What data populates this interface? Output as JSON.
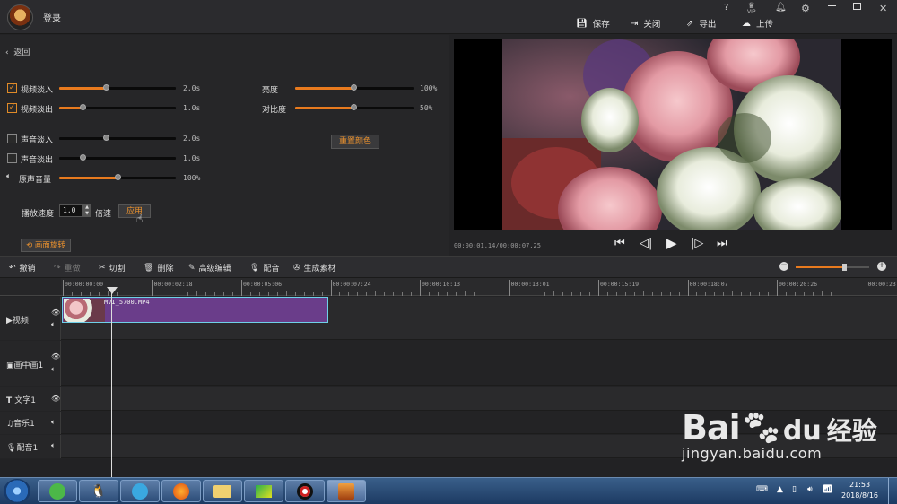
{
  "titlebar": {
    "login": "登录",
    "actions": {
      "save": "保存",
      "close": "关闭",
      "export": "导出",
      "upload": "上传"
    },
    "icons": [
      "help-icon",
      "vip-icon",
      "bell-icon",
      "gear-icon",
      "minimize-icon",
      "restore-icon",
      "close-icon"
    ],
    "help": "?",
    "vip": "VIP"
  },
  "left": {
    "back": "返回",
    "rows": [
      {
        "label": "视频淡入",
        "checked": true,
        "value": "2.0s",
        "level": 0.45
      },
      {
        "label": "视频淡出",
        "checked": true,
        "value": "1.0s",
        "level": 0.2
      },
      {
        "label": "声音淡入",
        "checked": false,
        "value": "2.0s",
        "level": 0.45
      },
      {
        "label": "声音淡出",
        "checked": false,
        "value": "1.0s",
        "level": 0.2
      },
      {
        "label": "原声音量",
        "value": "100%",
        "level": 0.5
      }
    ],
    "brightness": {
      "label": "亮度",
      "value": "100%",
      "level": 0.5
    },
    "contrast": {
      "label": "对比度",
      "value": "50%",
      "level": 0.5
    },
    "reset_color": "重置颜色",
    "speed_label": "播放速度",
    "speed_value": "1.0",
    "speed_unit": "倍速",
    "apply": "应用",
    "rotate": "画面旋转"
  },
  "preview": {
    "timecode": "00:00:01.14/00:00:07.25"
  },
  "toolbar": {
    "undo": "撤销",
    "redo": "重做",
    "cut": "切割",
    "delete": "删除",
    "advanced_edit": "高级编辑",
    "dub": "配音",
    "generate": "生成素材",
    "zoom_level": 0.7
  },
  "ruler": [
    "00:00:00:00",
    "00:00:02:18",
    "00:00:05:06",
    "00:00:07:24",
    "00:00:10:13",
    "00:00:13:01",
    "00:00:15:19",
    "00:00:18:07",
    "00:00:20:26",
    "00:00:23:"
  ],
  "tracks": {
    "video": "视频",
    "pip": "画中画1",
    "text": "文字1",
    "music": "音乐1",
    "dub": "配音1"
  },
  "clip": {
    "name": "MVI_5700.MP4"
  },
  "taskbar": {
    "time": "21:53",
    "date": "2018/8/16"
  },
  "watermark": {
    "brand": "Bai",
    "du": "du",
    "cn": "经验",
    "url": "jingyan.baidu.com"
  },
  "colors": {
    "accent": "#e87a1e",
    "clip": "#6a3d8a",
    "clip_border": "#6fd0e8"
  }
}
